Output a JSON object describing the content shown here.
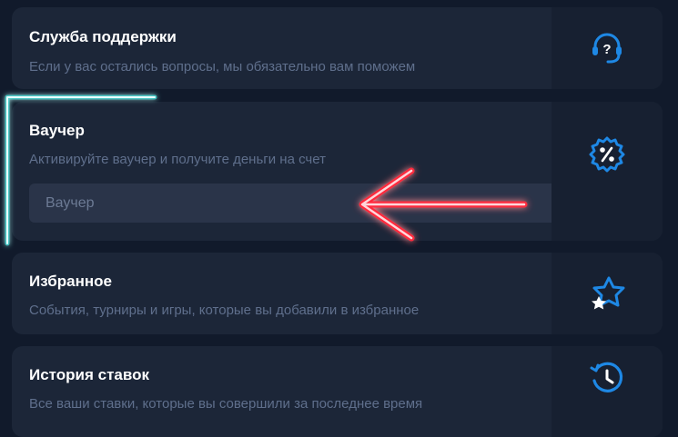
{
  "cards": [
    {
      "title": "Служба поддержки",
      "description": "Если у вас остались вопросы, мы обязательно вам поможем",
      "icon": "support-headset-icon"
    },
    {
      "title": "Ваучер",
      "description": "Активируйте ваучер и получите деньги на счет",
      "icon": "percent-badge-icon"
    },
    {
      "title": "Избранное",
      "description": "События, турниры и игры, которые вы добавили в избранное",
      "icon": "favorite-star-icon"
    },
    {
      "title": "История ставок",
      "description": "Все ваши ставки, которые вы совершили за последнее время",
      "icon": "history-clock-icon"
    }
  ],
  "voucher": {
    "placeholder": "Ваучер",
    "value": ""
  },
  "colors": {
    "background": "#111a2b",
    "card": "#1c2638",
    "accent_blue": "#1e88e5",
    "highlight_cyan": "#31e6e0",
    "arrow_red": "#ff2a3d"
  }
}
